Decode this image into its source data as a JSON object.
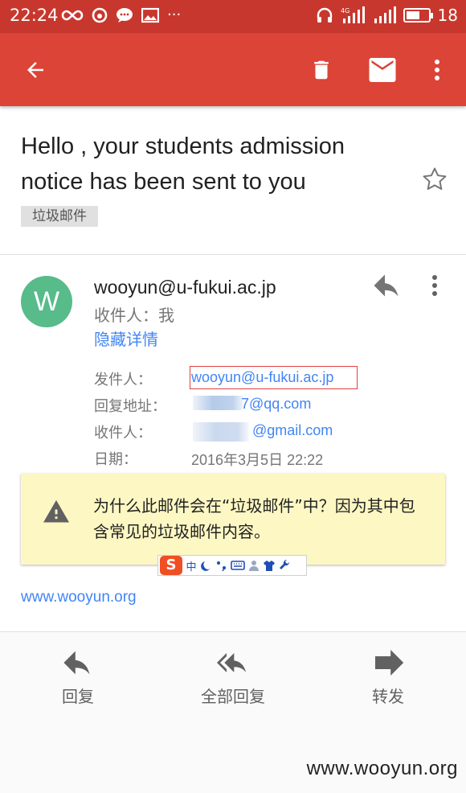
{
  "status_bar": {
    "time": "22:24",
    "network_type": "4G",
    "battery_level": 0.6,
    "battery_text": "18"
  },
  "app_bar": {
    "background": "#db4437",
    "actions": [
      "back",
      "delete",
      "mark-unread",
      "more"
    ]
  },
  "email": {
    "subject": "Hello , your students admission notice has been sent to you",
    "label": "垃圾邮件",
    "avatar_letter": "W",
    "avatar_color": "#57bb8a",
    "from_display": "wooyun@u-fukui.ac.jp",
    "to_line": "收件人：我",
    "hide_details": "隐藏详情",
    "details": {
      "from_label": "发件人：",
      "from_value": "wooyun@u-fukui.ac.jp",
      "reply_to_label": "回复地址：",
      "reply_to_value": "7@qq.com",
      "to_label": "收件人：",
      "to_value": "@gmail.com",
      "date_label": "日期：",
      "date_value": "2016年3月5日 22:22"
    },
    "spam_warning": "为什么此邮件会在“垃圾邮件”中？因为其中包含常见的垃圾邮件内容。",
    "body_link": "www.wooyun.org"
  },
  "ime_toolbar": {
    "logo": "S",
    "mode": "中"
  },
  "bottom_actions": {
    "reply": "回复",
    "reply_all": "全部回复",
    "forward": "转发"
  },
  "watermark": "www.wooyun.org"
}
